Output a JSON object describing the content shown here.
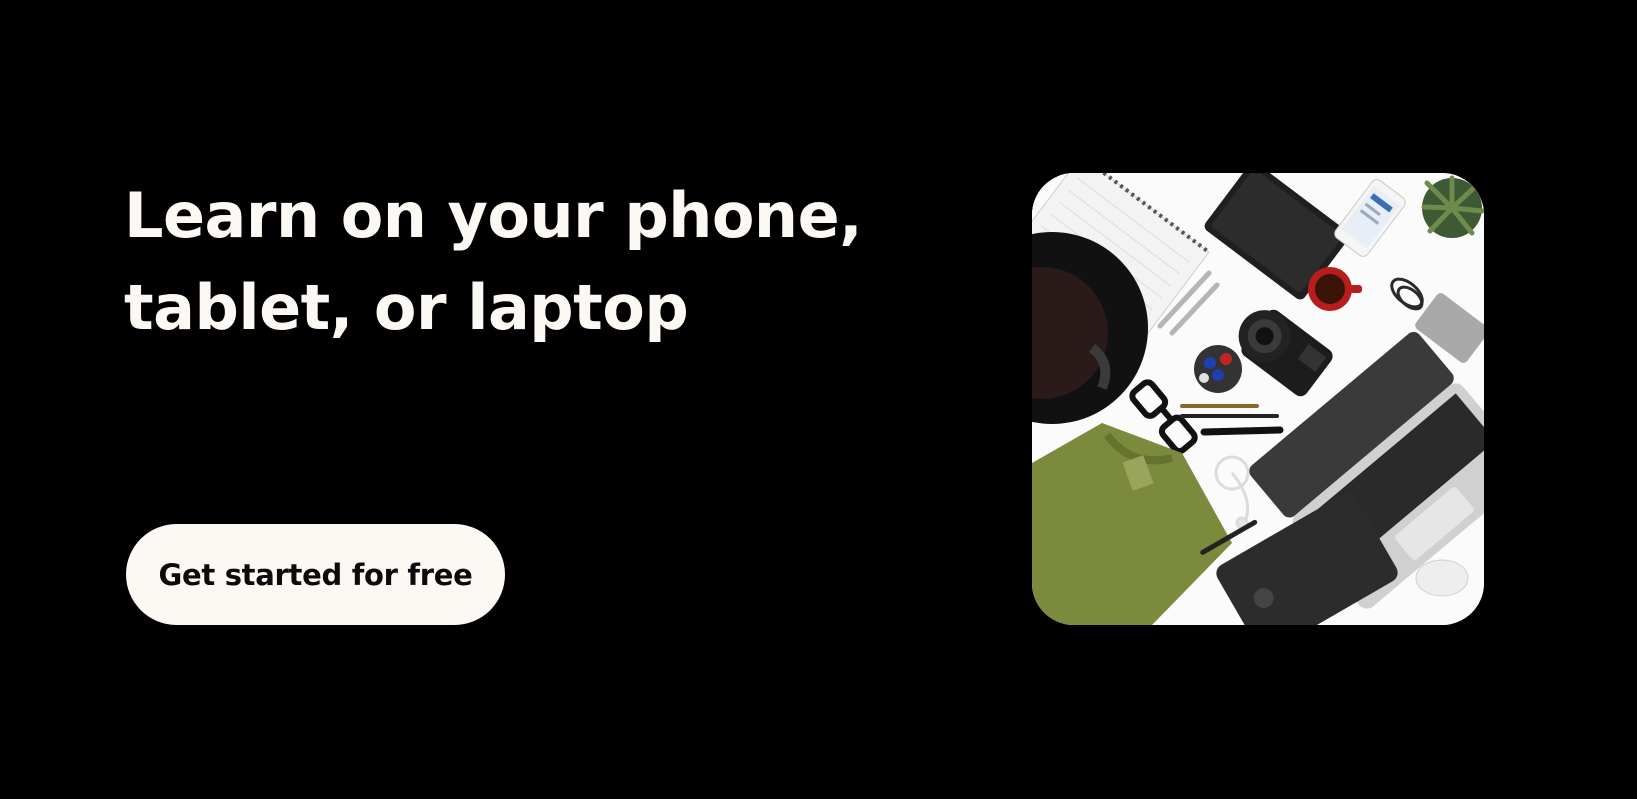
{
  "hero": {
    "headline_line1": "Learn on your phone,",
    "headline_line2": "tablet, or laptop",
    "cta_label": "Get started for free"
  },
  "image": {
    "description_icon": "devices-flatlay-photo"
  },
  "colors": {
    "background": "#000000",
    "headline": "#fcf8f3",
    "button_bg": "#fcf8f3",
    "button_text": "#0b0b0b"
  }
}
